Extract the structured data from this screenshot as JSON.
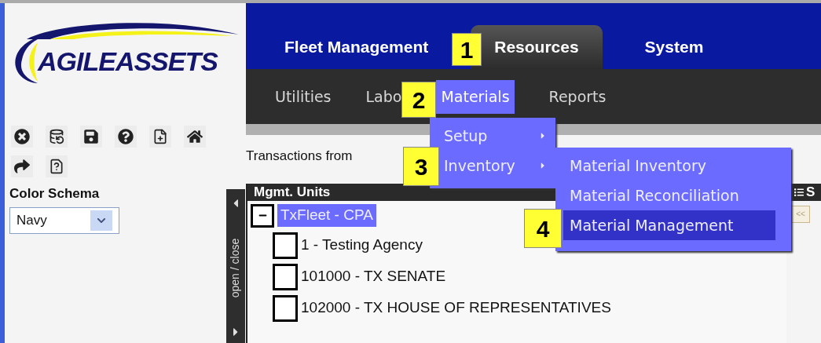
{
  "logo": {
    "text": "AGILEASSETS"
  },
  "color_schema": {
    "label": "Color Schema",
    "value": "Navy"
  },
  "tabs": [
    {
      "label": "Fleet Management",
      "selected": false
    },
    {
      "label": "Resources",
      "selected": true
    },
    {
      "label": "System",
      "selected": false
    }
  ],
  "subnav": [
    {
      "label": "Utilities",
      "selected": false
    },
    {
      "label": "Labo",
      "selected": false
    },
    {
      "label": "Materials",
      "selected": true
    },
    {
      "label": "Reports",
      "selected": false
    }
  ],
  "materials_menu": [
    {
      "label": "Setup"
    },
    {
      "label": "Inventory"
    }
  ],
  "inventory_submenu": [
    {
      "label": "Material Inventory",
      "selected": false
    },
    {
      "label": "Material Reconciliation",
      "selected": false
    },
    {
      "label": "Material Management",
      "selected": true
    }
  ],
  "transactions_label": "Transactions from",
  "panel_toggle": {
    "label": "open / close"
  },
  "tree": {
    "title": "Mgmt. Units",
    "items": [
      {
        "label": "TxFleet - CPA",
        "expanded": true,
        "selected": true,
        "children": [
          {
            "label": "1 - Testing Agency",
            "checked": false
          },
          {
            "label": "101000 - TX SENATE",
            "checked": false
          },
          {
            "label": "102000 - TX HOUSE OF REPRESENTATIVES",
            "checked": false
          }
        ]
      }
    ]
  },
  "side_panel": {
    "column_1": "S",
    "pager_button": "<<"
  },
  "callouts": [
    {
      "number": "1"
    },
    {
      "number": "2"
    },
    {
      "number": "3"
    },
    {
      "number": "4"
    }
  ]
}
